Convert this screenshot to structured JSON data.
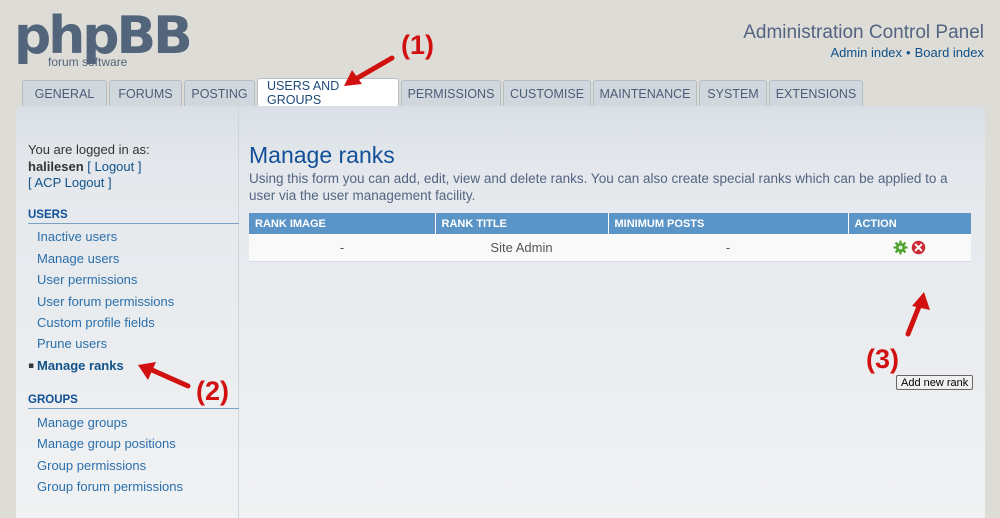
{
  "header": {
    "logo_main": "phpBB",
    "logo_sub": "forum software",
    "title": "Administration Control Panel",
    "admin_index": "Admin index",
    "separator": "•",
    "board_index": "Board index"
  },
  "tabs": [
    {
      "label": "GENERAL",
      "active": false
    },
    {
      "label": "FORUMS",
      "active": false
    },
    {
      "label": "POSTING",
      "active": false
    },
    {
      "label": "USERS AND GROUPS",
      "active": true
    },
    {
      "label": "PERMISSIONS",
      "active": false
    },
    {
      "label": "CUSTOMISE",
      "active": false
    },
    {
      "label": "MAINTENANCE",
      "active": false
    },
    {
      "label": "SYSTEM",
      "active": false
    },
    {
      "label": "EXTENSIONS",
      "active": false
    }
  ],
  "sidebar": {
    "logged_in_as": "You are logged in as:",
    "username": "halilesen",
    "logout": "[ Logout ]",
    "acp_logout": "[ ACP Logout ]",
    "users_header": "USERS",
    "users_items": [
      {
        "label": "Inactive users"
      },
      {
        "label": "Manage users"
      },
      {
        "label": "User permissions"
      },
      {
        "label": "User forum permissions"
      },
      {
        "label": "Custom profile fields"
      },
      {
        "label": "Prune users"
      },
      {
        "label": "Manage ranks",
        "active": true
      }
    ],
    "groups_header": "GROUPS",
    "groups_items": [
      {
        "label": "Manage groups"
      },
      {
        "label": "Manage group positions"
      },
      {
        "label": "Group permissions"
      },
      {
        "label": "Group forum permissions"
      }
    ]
  },
  "main": {
    "title": "Manage ranks",
    "description": "Using this form you can add, edit, view and delete ranks. You can also create special ranks which can be applied to a user via the user management facility.",
    "table": {
      "headers": [
        "RANK IMAGE",
        "RANK TITLE",
        "MINIMUM POSTS",
        "ACTION"
      ],
      "rows": [
        {
          "rank_image": "-",
          "rank_title": "Site Admin",
          "minimum_posts": "-",
          "actions": [
            "edit-gear-icon",
            "delete-icon"
          ]
        }
      ]
    },
    "add_button": "Add new rank"
  },
  "annotations": {
    "label_1": "(1)",
    "label_2": "(2)",
    "label_3": "(3)",
    "color": "#d11010"
  }
}
